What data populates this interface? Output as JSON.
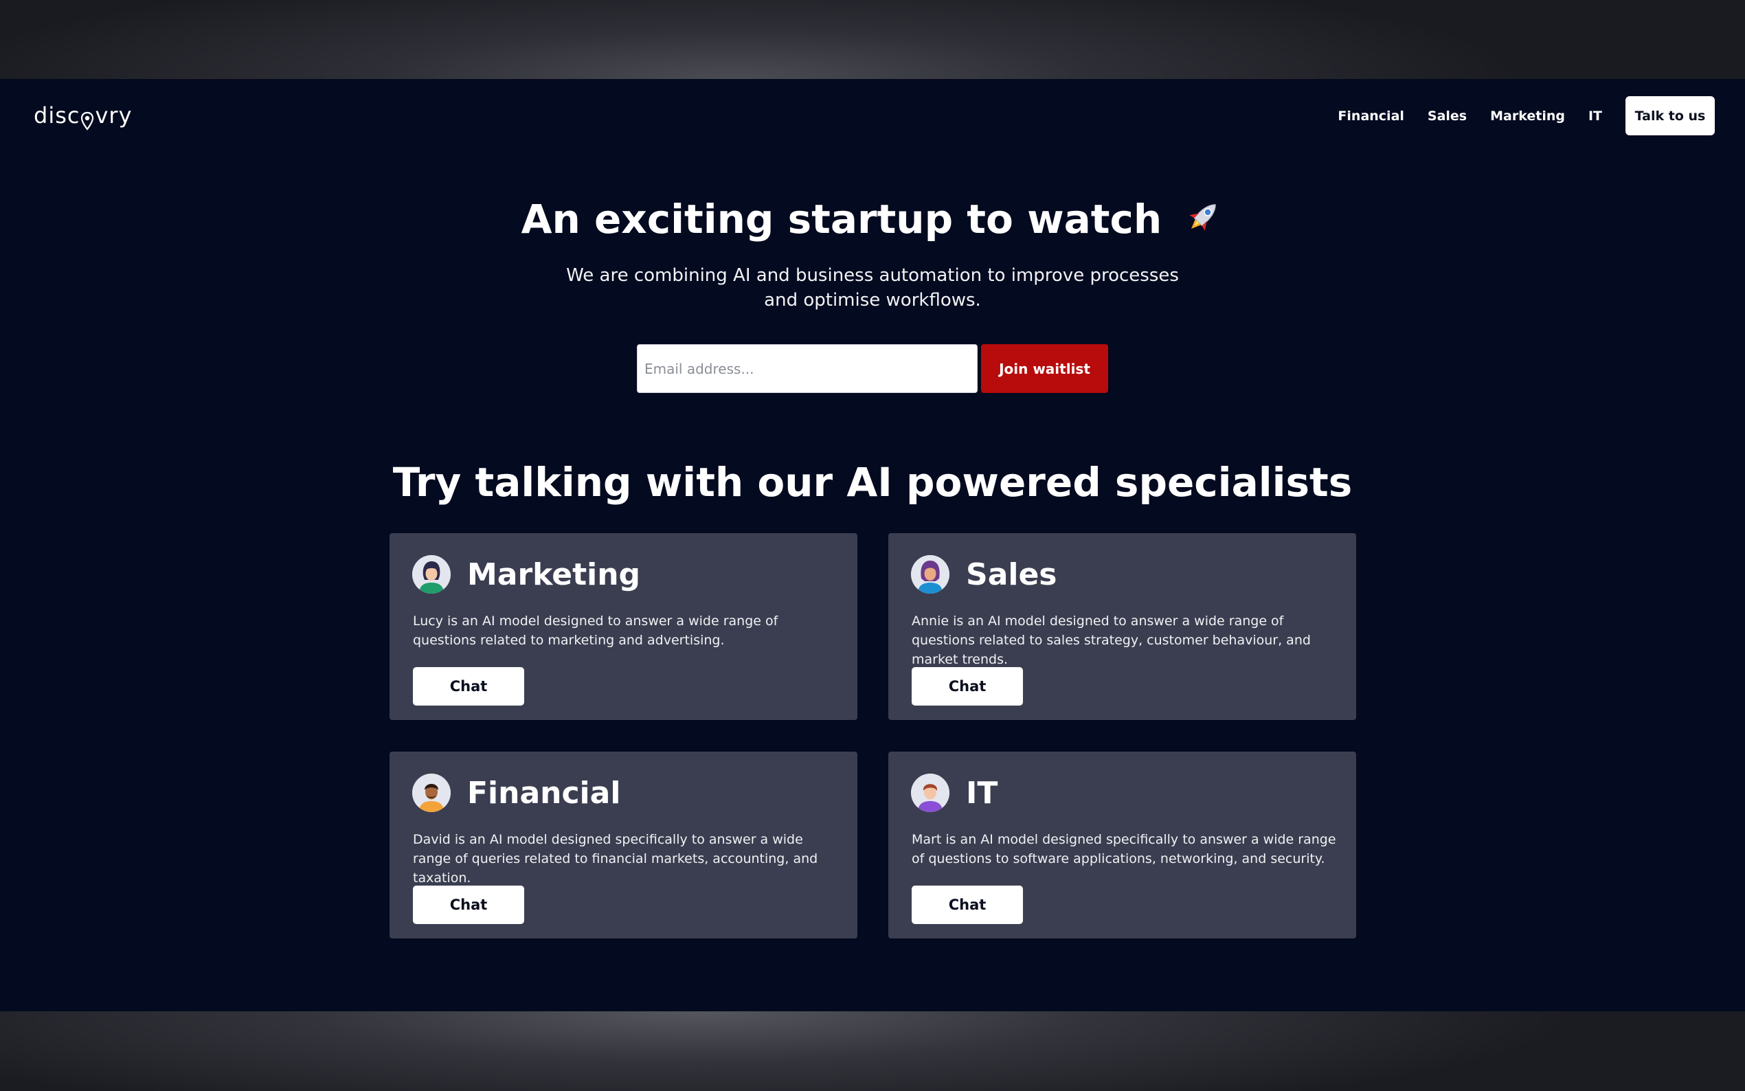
{
  "header": {
    "logo_text_left": "disc",
    "logo_text_right": "vry",
    "nav": [
      "Financial",
      "Sales",
      "Marketing",
      "IT"
    ],
    "cta_label": "Talk to us"
  },
  "hero": {
    "title": "An exciting startup to watch",
    "title_icon": "rocket-icon",
    "subtitle": "We are combining AI and business automation to improve processes and optimise workflows.",
    "email_placeholder": "Email address...",
    "join_label": "Join waitlist"
  },
  "specialists": {
    "title": "Try talking with our AI powered specialists",
    "cards": [
      {
        "title": "Marketing",
        "avatar": "woman-avatar",
        "description": "Lucy is an AI model designed to answer a wide range of questions related to marketing and advertising.",
        "button": "Chat"
      },
      {
        "title": "Sales",
        "avatar": "woman-avatar",
        "description": "Annie is an AI model designed to answer a wide range of questions related to sales strategy, customer behaviour, and market trends.",
        "button": "Chat"
      },
      {
        "title": "Financial",
        "avatar": "man-avatar",
        "description": "David is an AI model designed specifically to answer a wide range of queries related to financial markets, accounting, and taxation.",
        "button": "Chat"
      },
      {
        "title": "IT",
        "avatar": "man-avatar",
        "description": "Mart is an AI model designed specifically to answer a wide range of questions to software applications, networking, and security.",
        "button": "Chat"
      }
    ]
  },
  "colors": {
    "background": "#040a1f",
    "card": "#3b3e50",
    "accent": "#b80b0b"
  }
}
